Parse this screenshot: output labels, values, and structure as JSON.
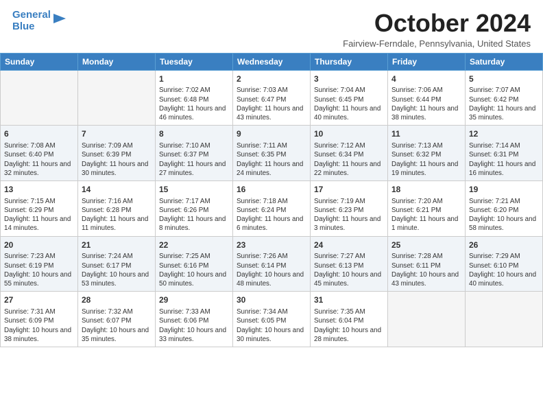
{
  "header": {
    "logo_line1": "General",
    "logo_line2": "Blue",
    "month_title": "October 2024",
    "location": "Fairview-Ferndale, Pennsylvania, United States"
  },
  "days_of_week": [
    "Sunday",
    "Monday",
    "Tuesday",
    "Wednesday",
    "Thursday",
    "Friday",
    "Saturday"
  ],
  "weeks": [
    [
      {
        "day": "",
        "info": ""
      },
      {
        "day": "",
        "info": ""
      },
      {
        "day": "1",
        "info": "Sunrise: 7:02 AM\nSunset: 6:48 PM\nDaylight: 11 hours and 46 minutes."
      },
      {
        "day": "2",
        "info": "Sunrise: 7:03 AM\nSunset: 6:47 PM\nDaylight: 11 hours and 43 minutes."
      },
      {
        "day": "3",
        "info": "Sunrise: 7:04 AM\nSunset: 6:45 PM\nDaylight: 11 hours and 40 minutes."
      },
      {
        "day": "4",
        "info": "Sunrise: 7:06 AM\nSunset: 6:44 PM\nDaylight: 11 hours and 38 minutes."
      },
      {
        "day": "5",
        "info": "Sunrise: 7:07 AM\nSunset: 6:42 PM\nDaylight: 11 hours and 35 minutes."
      }
    ],
    [
      {
        "day": "6",
        "info": "Sunrise: 7:08 AM\nSunset: 6:40 PM\nDaylight: 11 hours and 32 minutes."
      },
      {
        "day": "7",
        "info": "Sunrise: 7:09 AM\nSunset: 6:39 PM\nDaylight: 11 hours and 30 minutes."
      },
      {
        "day": "8",
        "info": "Sunrise: 7:10 AM\nSunset: 6:37 PM\nDaylight: 11 hours and 27 minutes."
      },
      {
        "day": "9",
        "info": "Sunrise: 7:11 AM\nSunset: 6:35 PM\nDaylight: 11 hours and 24 minutes."
      },
      {
        "day": "10",
        "info": "Sunrise: 7:12 AM\nSunset: 6:34 PM\nDaylight: 11 hours and 22 minutes."
      },
      {
        "day": "11",
        "info": "Sunrise: 7:13 AM\nSunset: 6:32 PM\nDaylight: 11 hours and 19 minutes."
      },
      {
        "day": "12",
        "info": "Sunrise: 7:14 AM\nSunset: 6:31 PM\nDaylight: 11 hours and 16 minutes."
      }
    ],
    [
      {
        "day": "13",
        "info": "Sunrise: 7:15 AM\nSunset: 6:29 PM\nDaylight: 11 hours and 14 minutes."
      },
      {
        "day": "14",
        "info": "Sunrise: 7:16 AM\nSunset: 6:28 PM\nDaylight: 11 hours and 11 minutes."
      },
      {
        "day": "15",
        "info": "Sunrise: 7:17 AM\nSunset: 6:26 PM\nDaylight: 11 hours and 8 minutes."
      },
      {
        "day": "16",
        "info": "Sunrise: 7:18 AM\nSunset: 6:24 PM\nDaylight: 11 hours and 6 minutes."
      },
      {
        "day": "17",
        "info": "Sunrise: 7:19 AM\nSunset: 6:23 PM\nDaylight: 11 hours and 3 minutes."
      },
      {
        "day": "18",
        "info": "Sunrise: 7:20 AM\nSunset: 6:21 PM\nDaylight: 11 hours and 1 minute."
      },
      {
        "day": "19",
        "info": "Sunrise: 7:21 AM\nSunset: 6:20 PM\nDaylight: 10 hours and 58 minutes."
      }
    ],
    [
      {
        "day": "20",
        "info": "Sunrise: 7:23 AM\nSunset: 6:19 PM\nDaylight: 10 hours and 55 minutes."
      },
      {
        "day": "21",
        "info": "Sunrise: 7:24 AM\nSunset: 6:17 PM\nDaylight: 10 hours and 53 minutes."
      },
      {
        "day": "22",
        "info": "Sunrise: 7:25 AM\nSunset: 6:16 PM\nDaylight: 10 hours and 50 minutes."
      },
      {
        "day": "23",
        "info": "Sunrise: 7:26 AM\nSunset: 6:14 PM\nDaylight: 10 hours and 48 minutes."
      },
      {
        "day": "24",
        "info": "Sunrise: 7:27 AM\nSunset: 6:13 PM\nDaylight: 10 hours and 45 minutes."
      },
      {
        "day": "25",
        "info": "Sunrise: 7:28 AM\nSunset: 6:11 PM\nDaylight: 10 hours and 43 minutes."
      },
      {
        "day": "26",
        "info": "Sunrise: 7:29 AM\nSunset: 6:10 PM\nDaylight: 10 hours and 40 minutes."
      }
    ],
    [
      {
        "day": "27",
        "info": "Sunrise: 7:31 AM\nSunset: 6:09 PM\nDaylight: 10 hours and 38 minutes."
      },
      {
        "day": "28",
        "info": "Sunrise: 7:32 AM\nSunset: 6:07 PM\nDaylight: 10 hours and 35 minutes."
      },
      {
        "day": "29",
        "info": "Sunrise: 7:33 AM\nSunset: 6:06 PM\nDaylight: 10 hours and 33 minutes."
      },
      {
        "day": "30",
        "info": "Sunrise: 7:34 AM\nSunset: 6:05 PM\nDaylight: 10 hours and 30 minutes."
      },
      {
        "day": "31",
        "info": "Sunrise: 7:35 AM\nSunset: 6:04 PM\nDaylight: 10 hours and 28 minutes."
      },
      {
        "day": "",
        "info": ""
      },
      {
        "day": "",
        "info": ""
      }
    ]
  ]
}
